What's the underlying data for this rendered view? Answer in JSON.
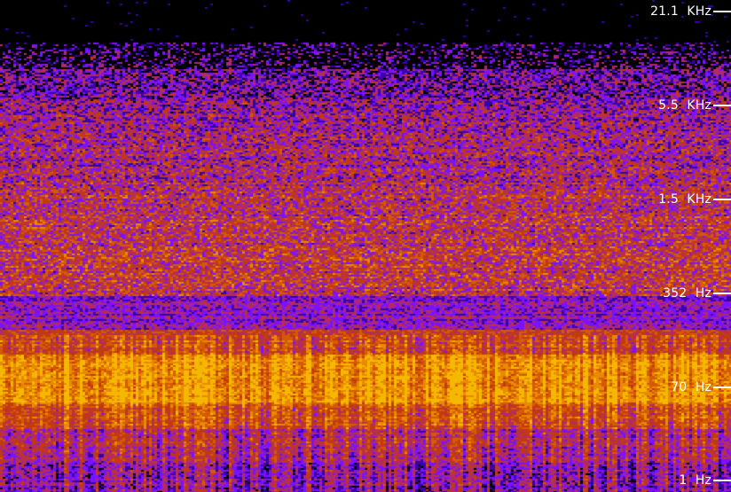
{
  "view": "spectrogram",
  "frequency_axis": {
    "scale": "log",
    "ticks": [
      {
        "label": "21.1  KHz",
        "hz": 21100
      },
      {
        "label": "5.5  KHz",
        "hz": 5500
      },
      {
        "label": "1.5  KHz",
        "hz": 1500
      },
      {
        "label": "352  Hz",
        "hz": 352
      },
      {
        "label": "70  Hz",
        "hz": 70
      },
      {
        "label": "1  Hz",
        "hz": 1
      }
    ]
  },
  "colormap": [
    "#000000",
    "#3a00a8",
    "#7a12ff",
    "#b02a6a",
    "#c23a10",
    "#d45a05",
    "#e98a00",
    "#f5b800"
  ]
}
